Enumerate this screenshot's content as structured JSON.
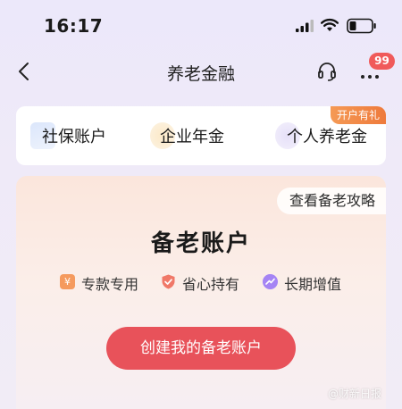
{
  "status_bar": {
    "time": "16:17"
  },
  "nav": {
    "title": "养老金融",
    "badge_count": "99"
  },
  "categories": {
    "items": [
      {
        "label": "社保账户"
      },
      {
        "label": "企业年金"
      },
      {
        "label": "个人养老金",
        "tag": "开户有礼"
      }
    ]
  },
  "account_card": {
    "guide_label": "查看备老攻略",
    "title": "备老账户",
    "features": [
      {
        "label": "专款专用",
        "icon_glyph": "¥"
      },
      {
        "label": "省心持有"
      },
      {
        "label": "长期增值"
      }
    ],
    "create_button": "创建我的备老账户"
  },
  "watermark": "@财新日报",
  "colors": {
    "accent_red": "#e8525a",
    "badge_red": "#f05a5a",
    "tag_orange": "#ee7a3c"
  }
}
